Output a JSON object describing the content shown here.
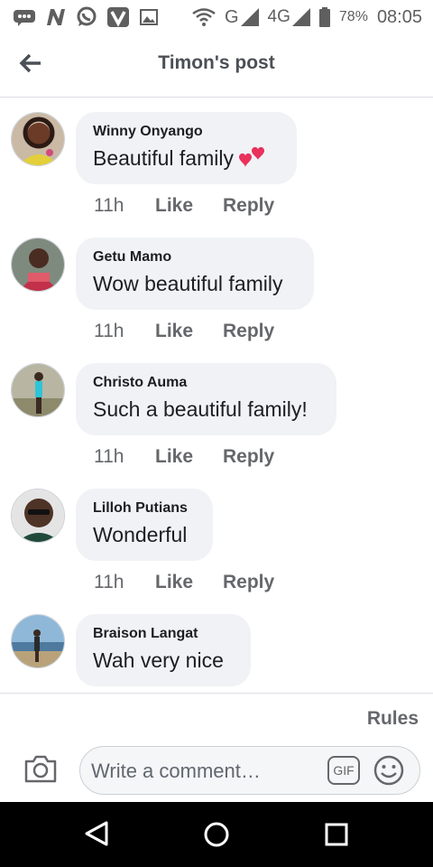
{
  "status_bar": {
    "notification_icons": [
      "message-icon",
      "n-app-icon",
      "whatsapp-icon",
      "v-app-icon",
      "image-icon"
    ],
    "network_1": "G",
    "network_2": "4G",
    "battery": "78%",
    "time": "08:05"
  },
  "header": {
    "title": "Timon's post"
  },
  "comments": [
    {
      "author": "Winny Onyango",
      "text": "Beautiful family",
      "has_heart_emoji": true,
      "time": "11h",
      "like_label": "Like",
      "reply_label": "Reply"
    },
    {
      "author": "Getu Mamo",
      "text": "Wow beautiful family",
      "time": "11h",
      "like_label": "Like",
      "reply_label": "Reply"
    },
    {
      "author": "Christo Auma",
      "text": "Such a beautiful family!",
      "time": "11h",
      "like_label": "Like",
      "reply_label": "Reply"
    },
    {
      "author": "Lilloh Putians",
      "text": "Wonderful",
      "time": "11h",
      "like_label": "Like",
      "reply_label": "Reply"
    },
    {
      "author": "Braison Langat",
      "text": "Wah very nice"
    }
  ],
  "composer": {
    "rules_label": "Rules",
    "placeholder": "Write a comment…",
    "gif_label": "GIF"
  },
  "colors": {
    "bubble": "#f0f2f5",
    "secondary_text": "#65676b",
    "nav_bar": "#000000"
  }
}
